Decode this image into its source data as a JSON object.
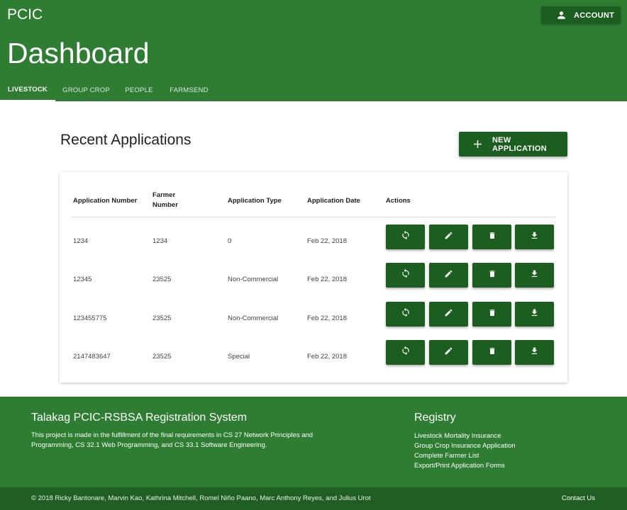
{
  "header": {
    "brand": "PCIC",
    "account_label": "ACCOUNT",
    "title": "Dashboard",
    "tabs": [
      {
        "label": "LIVESTOCK"
      },
      {
        "label": "GROUP CROP"
      },
      {
        "label": "PEOPLE"
      },
      {
        "label": "FARMSEND"
      }
    ]
  },
  "main": {
    "section_title": "Recent Applications",
    "new_button_label": "NEW APPLICATION",
    "table": {
      "columns": {
        "application_number": "Application Number",
        "farmer_number_1": "Farmer",
        "farmer_number_2": "Number",
        "application_type": "Application Type",
        "application_date": "Application Date",
        "actions": "Actions"
      },
      "rows": [
        {
          "application_number": "1234",
          "farmer_number": "1234",
          "application_type": "0",
          "application_date": "Feb 22, 2018"
        },
        {
          "application_number": "12345",
          "farmer_number": "23525",
          "application_type": "Non-Commercial",
          "application_date": "Feb 22, 2018"
        },
        {
          "application_number": "123455775",
          "farmer_number": "23525",
          "application_type": "Non-Commercial",
          "application_date": "Feb 22, 2018"
        },
        {
          "application_number": "2147483647",
          "farmer_number": "23525",
          "application_type": "Special",
          "application_date": "Feb 22, 2018"
        }
      ],
      "action_icons": [
        "refresh-icon",
        "pencil-icon",
        "trash-icon",
        "download-icon"
      ]
    }
  },
  "footer": {
    "title": "Talakag PCIC-RSBSA Registration System",
    "description": "This project is made in the fulfillment of the final requirements in CS 27 Network Principles and Programming, CS 32.1 Web Programming, and CS 33.1 Software Engineering.",
    "registry_title": "Registry",
    "registry_links": [
      {
        "label": "Livestock Mortality Insurance"
      },
      {
        "label": "Group Crop Insurance Application"
      },
      {
        "label": "Complete Farmer List"
      },
      {
        "label": "Export/Print Application Forms"
      }
    ],
    "copyright": "© 2018 Ricky Bantonare, Marvin Kao, Kathrina Mitchell, Romel Niño Paano, Marc Anthony Reyes, and Julius Urot",
    "contact_label": "Contact Us"
  },
  "colors": {
    "primary": "#2e7d32",
    "primary_dark": "#1b5e20"
  }
}
